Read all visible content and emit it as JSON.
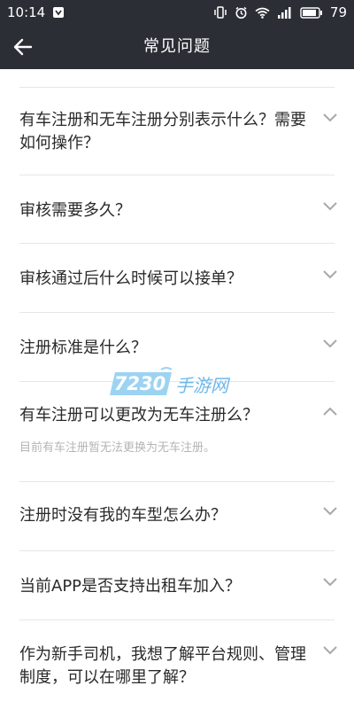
{
  "status_bar": {
    "time": "10:14",
    "battery": "79"
  },
  "header": {
    "title": "常见问题"
  },
  "faq": [
    {
      "question": "有车注册和无车注册分别表示什么？需要如何操作？",
      "expanded": false
    },
    {
      "question": "审核需要多久？",
      "expanded": false
    },
    {
      "question": "审核通过后什么时候可以接单？",
      "expanded": false
    },
    {
      "question": "注册标准是什么？",
      "expanded": false
    },
    {
      "question": "有车注册可以更改为无车注册么？",
      "expanded": true,
      "answer": "目前有车注册暂无法更换为无车注册。"
    },
    {
      "question": "注册时没有我的车型怎么办？",
      "expanded": false
    },
    {
      "question": "当前APP是否支持出租车加入？",
      "expanded": false
    },
    {
      "question": "作为新手司机，我想了解平台规则、管理制度，可以在哪里了解？",
      "expanded": false
    }
  ],
  "watermark": {
    "number": "7230",
    "text": "手游网"
  },
  "colors": {
    "bar": "#2b2e35",
    "question": "#2a2a2a",
    "answer": "#b5b5b5",
    "divider": "#e6e6e6",
    "chevron": "#a8a8a8"
  },
  "icons": {
    "back": "arrow-left-icon",
    "expand": "chevron-down-icon",
    "collapse": "chevron-up-icon"
  }
}
